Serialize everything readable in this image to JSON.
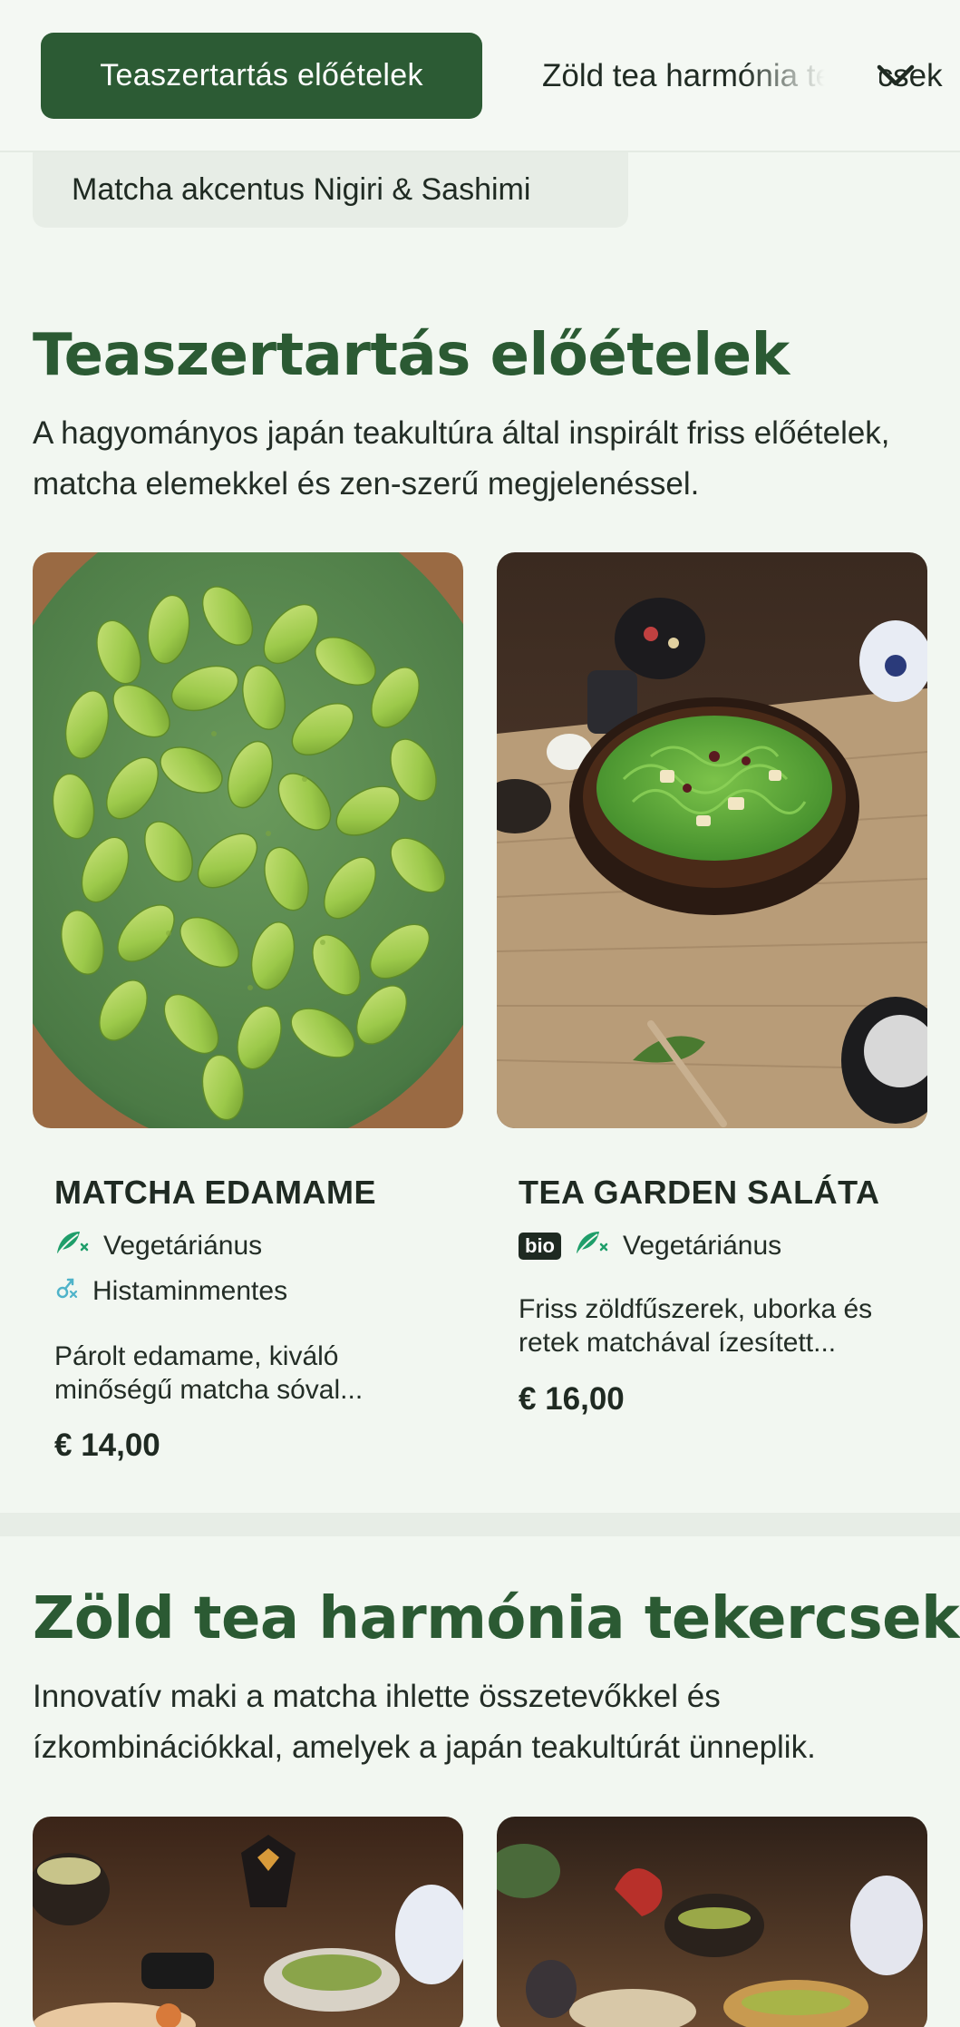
{
  "nav": {
    "active_tab": "Teaszertartás előételek",
    "second_tab": "Zöld tea harmónia tekercsek",
    "sub_tab": "Matcha akcentus Nigiri & Sashimi"
  },
  "sections": [
    {
      "title": "Teaszertartás előételek",
      "description": "A hagyományos japán teakultúra által inspirált friss előételek, matcha elemekkel és zen-szerű megjelenéssel.",
      "items": [
        {
          "name": "MATCHA EDAMAME",
          "tags": [
            "Vegetáriánus",
            "Histaminmentes"
          ],
          "description": "Párolt edamame, kiváló minőségű matcha sóval...",
          "price": "€ 14,00"
        },
        {
          "name": "TEA GARDEN SALÁTA",
          "badge": "bio",
          "tags": [
            "Vegetáriánus"
          ],
          "description": "Friss zöldfűszerek, uborka és retek matchával ízesített...",
          "price": "€ 16,00"
        }
      ]
    },
    {
      "title": "Zöld tea harmónia tekercsek",
      "description": "Innovatív maki a matcha ihlette összetevőkkel és ízkombinációkkal, amelyek a japán teakultúrát ünneplik."
    }
  ],
  "colors": {
    "accent": "#2c5b34",
    "background": "#f2f7f1",
    "veg_icon": "#1f9e6a",
    "histamine_icon": "#4fb3c9"
  },
  "icons": {
    "chevron": "chevron-down-icon",
    "vegetarian": "leaf-icon",
    "histamine": "histamine-free-icon"
  }
}
